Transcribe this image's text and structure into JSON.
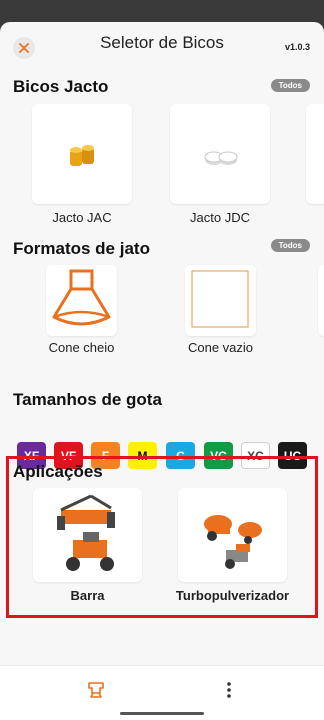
{
  "header": {
    "title": "Seletor de Bicos",
    "version": "v1.0.3"
  },
  "sections": {
    "nozzles": {
      "title": "Bicos Jacto",
      "pill": "Todos",
      "items": [
        {
          "label": "Jacto JAC"
        },
        {
          "label": "Jacto JDC"
        }
      ]
    },
    "jets": {
      "title": "Formatos de jato",
      "pill": "Todos",
      "items": [
        {
          "label": "Cone cheio"
        },
        {
          "label": "Cone vazio"
        }
      ]
    },
    "drops": {
      "title": "Tamanhos de gota",
      "items": [
        {
          "label": "XF",
          "color": "#6a2a9e",
          "text_color": "#ffffff"
        },
        {
          "label": "VF",
          "color": "#e0141e",
          "text_color": "#ffffff"
        },
        {
          "label": "F",
          "color": "#f58220",
          "text_color": "#ffffff"
        },
        {
          "label": "M",
          "color": "#ffef00",
          "text_color": "#111111"
        },
        {
          "label": "C",
          "color": "#1ba8e0",
          "text_color": "#ffffff"
        },
        {
          "label": "VC",
          "color": "#139a47",
          "text_color": "#ffffff"
        },
        {
          "label": "XC",
          "color": "#ffffff",
          "text_color": "#444444"
        },
        {
          "label": "UC",
          "color": "#1a1a1a",
          "text_color": "#ffffff"
        }
      ]
    },
    "applications": {
      "title": "Aplicações",
      "items": [
        {
          "label": "Barra"
        },
        {
          "label": "Turbopulverizador"
        }
      ]
    }
  },
  "colors": {
    "accent": "#e8701e",
    "highlight_border": "#e0141e"
  }
}
